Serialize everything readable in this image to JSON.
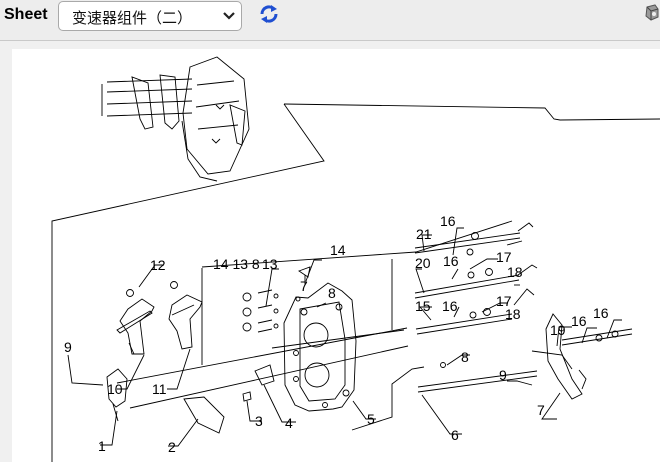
{
  "toolbar": {
    "sheet_label": "Sheet",
    "selected_sheet": "变速器组件（二）",
    "icons": {
      "dropdown": "chevron-down-icon",
      "refresh": "refresh-icon",
      "corner": "printer-icon"
    }
  },
  "drawing": {
    "callouts": [
      "1",
      "2",
      "3",
      "4",
      "5",
      "6",
      "7",
      "7",
      "8",
      "8",
      "9",
      "9",
      "10",
      "11",
      "12",
      "13",
      "14",
      "14 13 8",
      "15",
      "16",
      "16",
      "16",
      "16",
      "16",
      "17",
      "17",
      "18",
      "18",
      "19",
      "20",
      "21"
    ]
  }
}
